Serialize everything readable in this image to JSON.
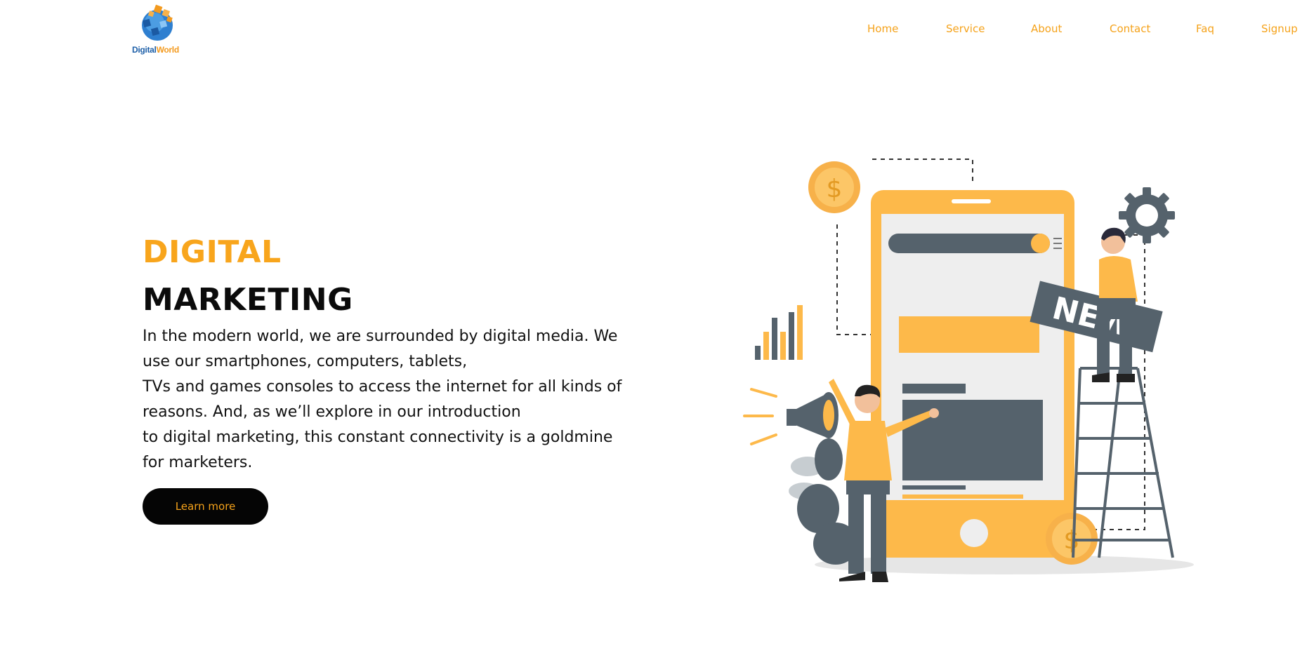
{
  "logo": {
    "text_part1": "Digital",
    "text_part2": "World",
    "icon": "globe-cube-icon"
  },
  "nav": {
    "items": [
      {
        "label": "Home"
      },
      {
        "label": "Service"
      },
      {
        "label": "About"
      },
      {
        "label": "Contact"
      },
      {
        "label": "Faq"
      },
      {
        "label": "Signup"
      }
    ]
  },
  "hero": {
    "title_line1": "DIGITAL",
    "title_line2": "MARKETING",
    "paragraph_lines": [
      "In the modern world, we are surrounded by digital media. We",
      "use our smartphones, computers, tablets,",
      "TVs and games consoles to access the internet for all kinds of",
      "reasons. And, as we’ll explore in our introduction",
      "to digital marketing, this constant connectivity is a goldmine",
      "for marketers."
    ],
    "cta_label": "Learn more"
  },
  "illustration": {
    "badge_text": "NEW",
    "currency_symbol": "$"
  },
  "colors": {
    "accent": "#f8a51c",
    "dark": "#050505",
    "slate": "#55626c",
    "phone": "#fdb94a"
  }
}
